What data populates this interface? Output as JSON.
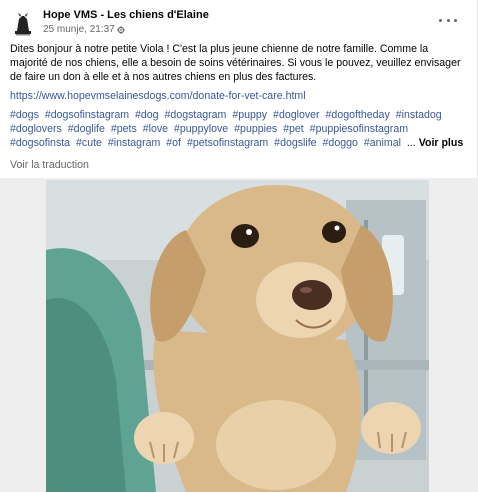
{
  "post": {
    "page_name": "Hope VMS - Les chiens d'Elaine",
    "timestamp": "25 munje, 21:37",
    "avatar_icon": "dog-logo-icon",
    "body": "Dites bonjour à notre petite Viola ! C'est la plus jeune chienne de notre famille. Comme la majorité de nos chiens, elle a besoin de soins vétérinaires. Si vous le pouvez, veuillez envisager de faire un don à elle et à nos autres chiens en plus des factures.",
    "link": "https://www.hopevmselainesdogs.com/donate-for-vet-care.html",
    "hashtags": [
      "#dogs",
      "#dogsofinstagram",
      "#dog",
      "#dogstagram",
      "#puppy",
      "#doglover",
      "#dogoftheday",
      "#instadog",
      "#doglovers",
      "#doglife",
      "#pets",
      "#love",
      "#puppylove",
      "#puppies",
      "#pet",
      "#puppiesofinstagram",
      "#dogsofinsta",
      "#cute",
      "#instagram",
      "#of",
      "#petsofinstagram",
      "#dogslife",
      "#doggo",
      "#animal"
    ],
    "ellipsis": "...",
    "see_more": "Voir plus",
    "translate": "Voir la traduction",
    "photo_icon": "puppy-photo",
    "colors": {
      "link": "#385898",
      "secondary_text": "#65676b",
      "scrubs": "#5fa394",
      "glove": "#d98fb4",
      "puppy_fur": "#d9b98a"
    }
  }
}
